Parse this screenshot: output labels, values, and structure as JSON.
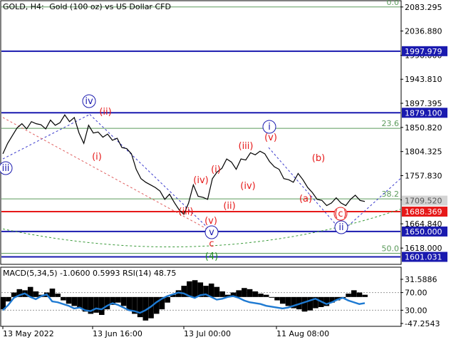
{
  "header": {
    "symbol": "GOLD, H4:",
    "description": "Gold (100 oz) vs US Dollar CFD"
  },
  "chart_data": [
    {
      "type": "line",
      "panel": "price",
      "ylim": [
        1588,
        2094
      ],
      "price_axis_ticks": [
        "2083.295",
        "2036.880",
        "1990.000",
        "1943.810",
        "1897.395",
        "1850.820",
        "1804.325",
        "1757.830",
        "1711.025",
        "1664.840",
        "1618.000"
      ],
      "x_labels": [
        "13 May 2022",
        "13 Jun 16:00",
        "13 Jul 00:00",
        "11 Aug 08:00"
      ],
      "levels": [
        {
          "price": 1997.979,
          "label": "1997.979",
          "color": "#1a1aaf",
          "style": "solid",
          "tag": true
        },
        {
          "price": 1879.1,
          "label": "1879.100",
          "color": "#1a1aaf",
          "style": "solid",
          "tag": true
        },
        {
          "price": 1709.52,
          "label": "1709.520",
          "color": "#c8c8c8",
          "style": "tag-only",
          "tag": true
        },
        {
          "price": 1688.369,
          "label": "1688.369",
          "color": "#e61919",
          "style": "solid",
          "tag": true
        },
        {
          "price": 1650.0,
          "label": "1650.000",
          "color": "#1a1aaf",
          "style": "solid",
          "tag": true
        },
        {
          "price": 1601.031,
          "label": "1601.031",
          "color": "#1a1aaf",
          "style": "solid",
          "tag": true
        }
      ],
      "fibonacci": [
        {
          "label": "0.0",
          "price": 2083.3
        },
        {
          "label": "23.6",
          "price": 1849.0
        },
        {
          "label": "38.2",
          "price": 1713.0
        },
        {
          "label": "50.0",
          "price": 1608.0
        }
      ],
      "wave_labels": [
        {
          "text": "(4)",
          "color": "#1a8a1a",
          "style": "plain"
        },
        {
          "text": "iii",
          "color": "#1a1aaf",
          "style": "circle"
        },
        {
          "text": "iv",
          "color": "#1a1aaf",
          "style": "circle"
        },
        {
          "text": "i",
          "color": "#1a1aaf",
          "style": "circle"
        },
        {
          "text": "ii",
          "color": "#1a1aaf",
          "style": "circle"
        },
        {
          "text": "v",
          "color": "#1a1aaf",
          "style": "circle"
        },
        {
          "text": "(i)",
          "color": "#e61919",
          "style": "plain"
        },
        {
          "text": "(ii)",
          "color": "#e61919",
          "style": "plain"
        },
        {
          "text": "(iii)",
          "color": "#e61919",
          "style": "plain"
        },
        {
          "text": "(iv)",
          "color": "#e61919",
          "style": "plain"
        },
        {
          "text": "(v)",
          "color": "#e61919",
          "style": "plain"
        },
        {
          "text": "(i)",
          "color": "#e61919",
          "style": "plain"
        },
        {
          "text": "(ii)",
          "color": "#e61919",
          "style": "plain"
        },
        {
          "text": "(iii)",
          "color": "#e61919",
          "style": "plain"
        },
        {
          "text": "(iv)",
          "color": "#e61919",
          "style": "plain"
        },
        {
          "text": "(v)",
          "color": "#e61919",
          "style": "plain"
        },
        {
          "text": "(a)",
          "color": "#e61919",
          "style": "plain"
        },
        {
          "text": "(b)",
          "color": "#e61919",
          "style": "plain"
        },
        {
          "text": "(c)",
          "color": "#e61919",
          "style": "circle"
        },
        {
          "text": "c",
          "color": "#e61919",
          "style": "plain"
        }
      ],
      "price_series": [
        [
          "13 May 2022",
          1800
        ],
        [
          "",
          1820
        ],
        [
          "",
          1835
        ],
        [
          "",
          1850
        ],
        [
          "",
          1858
        ],
        [
          "",
          1848
        ],
        [
          "",
          1862
        ],
        [
          "",
          1858
        ],
        [
          "",
          1856
        ],
        [
          "",
          1848
        ],
        [
          "",
          1865
        ],
        [
          "",
          1855
        ],
        [
          "",
          1860
        ],
        [
          "",
          1875
        ],
        [
          "",
          1862
        ],
        [
          "",
          1870
        ],
        [
          "",
          1840
        ],
        [
          "13 Jun 16:00",
          1820
        ],
        [
          "",
          1855
        ],
        [
          "",
          1840
        ],
        [
          "",
          1842
        ],
        [
          "",
          1832
        ],
        [
          "",
          1838
        ],
        [
          "",
          1826
        ],
        [
          "",
          1830
        ],
        [
          "",
          1812
        ],
        [
          "",
          1810
        ],
        [
          "",
          1800
        ],
        [
          "",
          1770
        ],
        [
          "",
          1752
        ],
        [
          "",
          1745
        ],
        [
          "",
          1740
        ],
        [
          "",
          1735
        ],
        [
          "",
          1728
        ],
        [
          "",
          1712
        ],
        [
          "",
          1722
        ],
        [
          "",
          1706
        ],
        [
          "",
          1692
        ],
        [
          "13 Jul 00:00",
          1683
        ],
        [
          "",
          1705
        ],
        [
          "",
          1740
        ],
        [
          "",
          1718
        ],
        [
          "",
          1716
        ],
        [
          "",
          1712
        ],
        [
          "",
          1752
        ],
        [
          "",
          1765
        ],
        [
          "",
          1772
        ],
        [
          "",
          1790
        ],
        [
          "",
          1784
        ],
        [
          "",
          1770
        ],
        [
          "",
          1790
        ],
        [
          "",
          1788
        ],
        [
          "",
          1802
        ],
        [
          "",
          1798
        ],
        [
          "11 Aug 08:00",
          1805
        ],
        [
          "",
          1800
        ],
        [
          "",
          1785
        ],
        [
          "",
          1775
        ],
        [
          "",
          1770
        ],
        [
          "",
          1752
        ],
        [
          "",
          1750
        ],
        [
          "",
          1745
        ],
        [
          "",
          1762
        ],
        [
          "",
          1750
        ],
        [
          "",
          1735
        ],
        [
          "",
          1725
        ],
        [
          "",
          1712
        ],
        [
          "",
          1710
        ],
        [
          "",
          1700
        ],
        [
          "",
          1705
        ],
        [
          "",
          1715
        ],
        [
          "",
          1705
        ],
        [
          "",
          1700
        ],
        [
          "",
          1712
        ],
        [
          "",
          1720
        ],
        [
          "",
          1710
        ],
        [
          "",
          1708
        ]
      ],
      "wedge_line": {
        "from_price": 1850,
        "to_price": 1765
      }
    },
    {
      "type": "area",
      "panel": "indicator",
      "title": "MACD(5,34,5) -1.0600 0.5993 RSI(14) 48.75",
      "axis_ticks": [
        "31.5886",
        "70.00",
        "30.00",
        "-47.2543"
      ],
      "macd_ylim": [
        -47.2543,
        31.5886
      ],
      "rsi_ylim": [
        0,
        100
      ],
      "rsi_levels": [
        70,
        30
      ],
      "macd_values": [
        -22,
        -8,
        8,
        14,
        12,
        18,
        10,
        4,
        8,
        15,
        6,
        -6,
        -12,
        -16,
        -20,
        -26,
        -30,
        -28,
        -32,
        -22,
        -14,
        -10,
        -16,
        -24,
        -30,
        -36,
        -42,
        -38,
        -30,
        -22,
        -10,
        4,
        12,
        20,
        28,
        30,
        26,
        20,
        24,
        18,
        10,
        4,
        8,
        12,
        16,
        14,
        10,
        6,
        4,
        0,
        -6,
        -12,
        -16,
        -20,
        -22,
        -26,
        -24,
        -20,
        -18,
        -16,
        -10,
        -6,
        -2,
        6,
        12,
        8,
        4
      ],
      "rsi_values": [
        30,
        42,
        58,
        64,
        68,
        60,
        55,
        62,
        66,
        50,
        48,
        44,
        40,
        34,
        36,
        30,
        28,
        34,
        32,
        40,
        46,
        42,
        36,
        30,
        28,
        24,
        30,
        38,
        48,
        56,
        62,
        66,
        70,
        68,
        62,
        58,
        64,
        66,
        60,
        54,
        56,
        60,
        62,
        58,
        52,
        48,
        46,
        44,
        40,
        38,
        36,
        34,
        36,
        40,
        44,
        48,
        52,
        56,
        50,
        44,
        48,
        54,
        58,
        52,
        48,
        44,
        46
      ]
    }
  ],
  "colors": {
    "price_line": "#000000",
    "blue_lines": "#1a1aaf",
    "red_line": "#e61919",
    "fib_lines": "#5a9a5a",
    "trend_dashed_blue": "#3a3acd",
    "trend_dashed_red": "#e06060",
    "trend_dashed_green": "#3a9a3a",
    "rsi_line": "#1e7ad2",
    "macd_area": "#000000"
  }
}
